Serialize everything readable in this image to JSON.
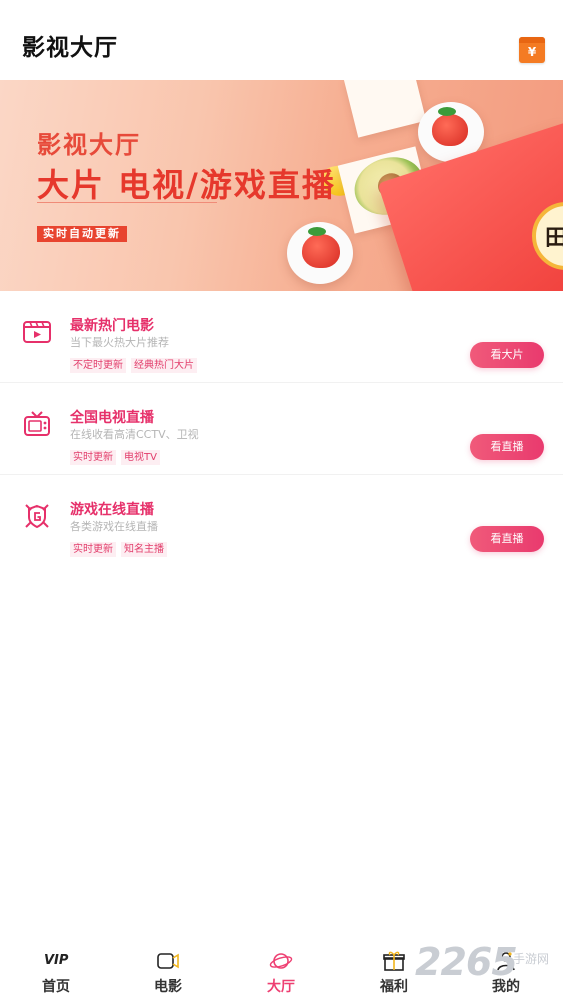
{
  "header": {
    "title": "影视大厅",
    "wallet_icon": "wallet-icon",
    "wallet_symbol": "¥"
  },
  "banner": {
    "line1": "影视大厅",
    "line2": "大片 电视/游戏直播",
    "tag": "实时自动更新",
    "coin_text": "田"
  },
  "items": [
    {
      "name": "最新热门电影",
      "subtitle": "当下最火热大片推荐",
      "tags": [
        "不定时更新",
        "经典热门大片"
      ],
      "button": "看大片",
      "icon": "film-icon"
    },
    {
      "name": "全国电视直播",
      "subtitle": "在线收看高清CCTV、卫视",
      "tags": [
        "实时更新",
        "电视TV"
      ],
      "button": "看直播",
      "icon": "tv-icon"
    },
    {
      "name": "游戏在线直播",
      "subtitle": "各类游戏在线直播",
      "tags": [
        "实时更新",
        "知名主播"
      ],
      "button": "看直播",
      "icon": "game-badge-icon"
    }
  ],
  "nav": [
    {
      "label": "首页",
      "icon": "vip-icon",
      "icon_text": "VIP"
    },
    {
      "label": "电影",
      "icon": "camera-icon"
    },
    {
      "label": "大厅",
      "icon": "planet-icon",
      "active": true
    },
    {
      "label": "福利",
      "icon": "gift-icon"
    },
    {
      "label": "我的",
      "icon": "profile-icon"
    }
  ],
  "watermark": {
    "number": "2265",
    "text": "手游网"
  },
  "colors": {
    "accent": "#e93a6e",
    "banner_text": "#e6382c",
    "wallet": "#f47b23"
  }
}
